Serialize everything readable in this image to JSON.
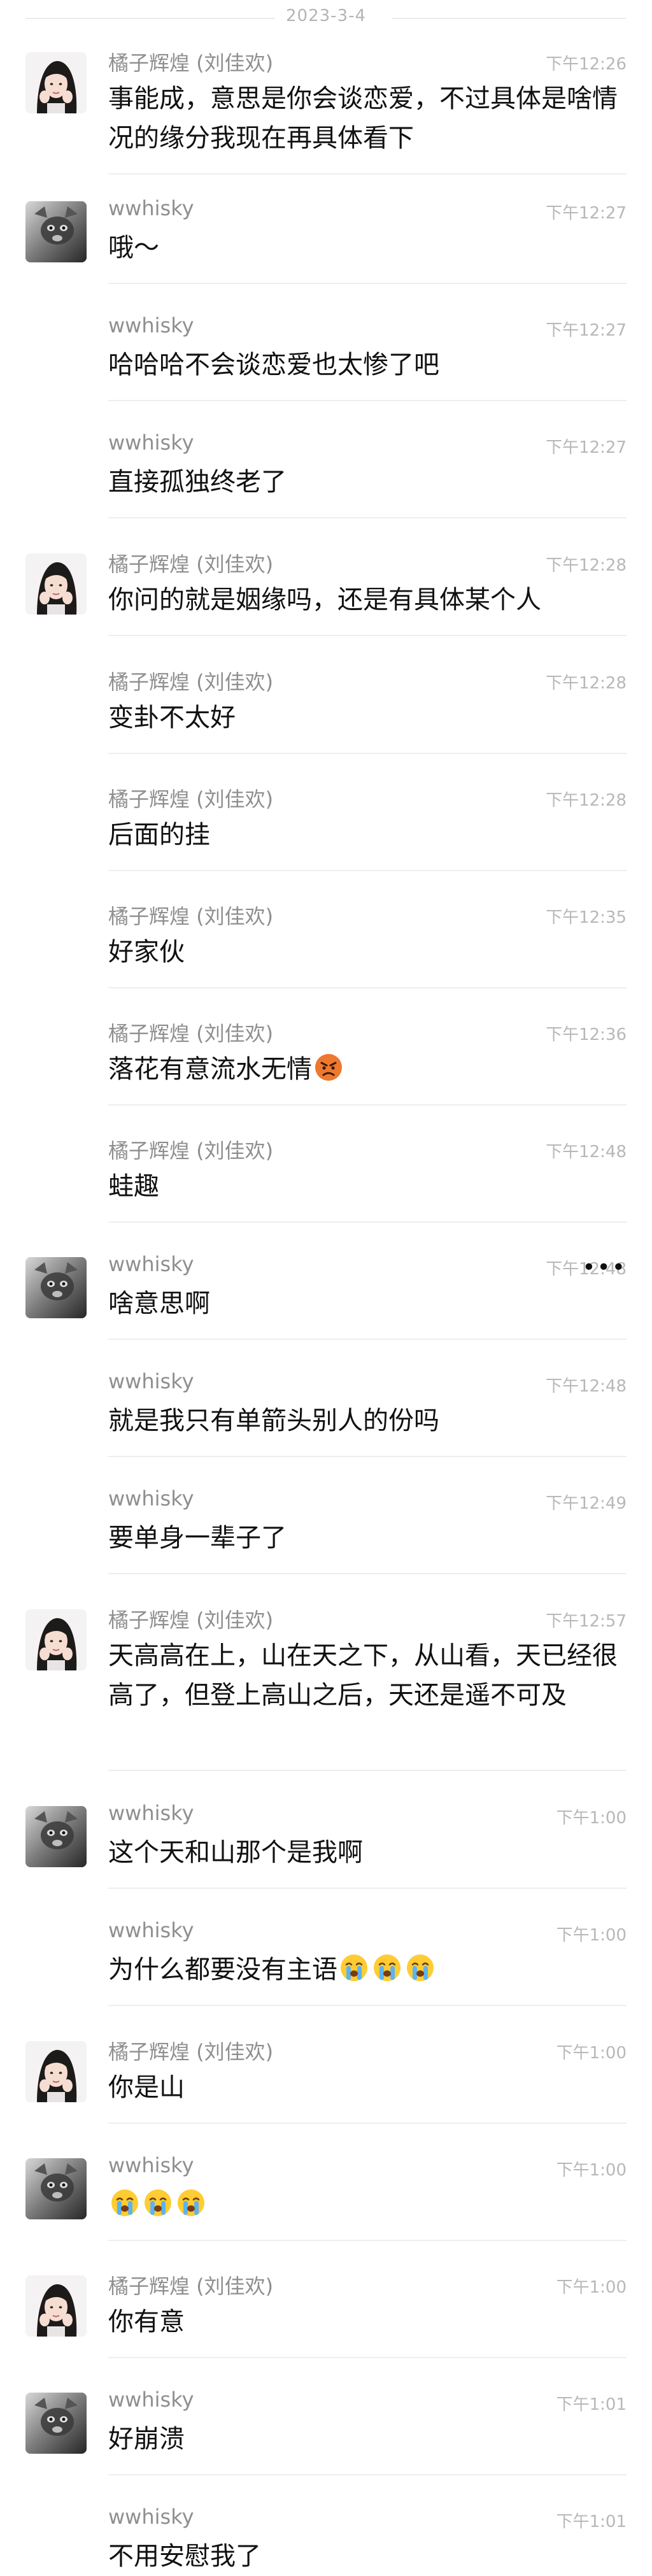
{
  "header": {
    "date": "2023-3-4"
  },
  "messages": [
    {
      "sender": "橘子辉煌 (刘佳欢)",
      "time": "下午12:26",
      "text": "事能成，意思是你会谈恋爱，不过具体是啥情况的缘分我现在再具体看下",
      "avatar": "female"
    },
    {
      "sender": "wwhisky",
      "time": "下午12:27",
      "text": "哦～",
      "avatar": "male"
    },
    {
      "sender": "wwhisky",
      "time": "下午12:27",
      "text": "哈哈哈不会谈恋爱也太惨了吧",
      "avatar": "none"
    },
    {
      "sender": "wwhisky",
      "time": "下午12:27",
      "text": "直接孤独终老了",
      "avatar": "none"
    },
    {
      "sender": "橘子辉煌 (刘佳欢)",
      "time": "下午12:28",
      "text": "你问的就是姻缘吗，还是有具体某个人",
      "avatar": "female"
    },
    {
      "sender": "橘子辉煌 (刘佳欢)",
      "time": "下午12:28",
      "text": "变卦不太好",
      "avatar": "none"
    },
    {
      "sender": "橘子辉煌 (刘佳欢)",
      "time": "下午12:28",
      "text": "后面的挂",
      "avatar": "none"
    },
    {
      "sender": "橘子辉煌 (刘佳欢)",
      "time": "下午12:35",
      "text": "好家伙",
      "avatar": "none"
    },
    {
      "sender": "橘子辉煌 (刘佳欢)",
      "time": "下午12:36",
      "text": "落花有意流水无情",
      "avatar": "none",
      "emoji": "pouting-face-icon",
      "emoji_count": 1
    },
    {
      "sender": "橘子辉煌 (刘佳欢)",
      "time": "下午12:48",
      "text": "蛙趣",
      "avatar": "none"
    },
    {
      "sender": "wwhisky",
      "time": "下午12:48",
      "text": "啥意思啊",
      "avatar": "male",
      "more": "•••"
    },
    {
      "sender": "wwhisky",
      "time": "下午12:48",
      "text": "就是我只有单箭头别人的份吗",
      "avatar": "none"
    },
    {
      "sender": "wwhisky",
      "time": "下午12:49",
      "text": "要单身一辈子了",
      "avatar": "none"
    },
    {
      "sender": "橘子辉煌 (刘佳欢)",
      "time": "下午12:57",
      "text": "天高高在上，山在天之下，从山看，天已经很高了，但登上高山之后，天还是遥不可及",
      "avatar": "female"
    },
    {
      "sender": "wwhisky",
      "time": "下午1:00",
      "text": "这个天和山那个是我啊",
      "avatar": "male"
    },
    {
      "sender": "wwhisky",
      "time": "下午1:00",
      "text": "为什么都要没有主语",
      "avatar": "none",
      "emoji": "crying-face-icon",
      "emoji_count": 3
    },
    {
      "sender": "橘子辉煌 (刘佳欢)",
      "time": "下午1:00",
      "text": "你是山",
      "avatar": "female"
    },
    {
      "sender": "wwhisky",
      "time": "下午1:00",
      "text": "",
      "avatar": "male",
      "emoji": "crying-face-icon",
      "emoji_count": 3
    },
    {
      "sender": "橘子辉煌 (刘佳欢)",
      "time": "下午1:00",
      "text": "你有意",
      "avatar": "female"
    },
    {
      "sender": "wwhisky",
      "time": "下午1:01",
      "text": "好崩溃",
      "avatar": "male"
    },
    {
      "sender": "wwhisky",
      "time": "下午1:01",
      "text": "不用安慰我了",
      "avatar": "none"
    }
  ]
}
